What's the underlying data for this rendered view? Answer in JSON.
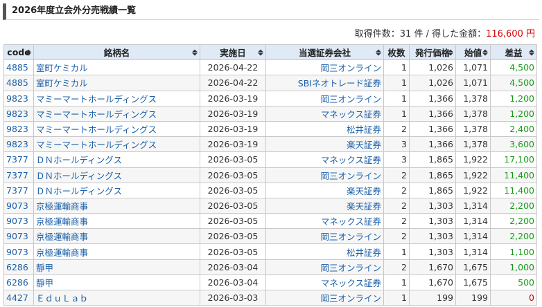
{
  "page_title": "2026年度立会外分売戦績一覧",
  "summary": {
    "prefix": "取得件数：31 件 / 得した金額：",
    "amount": "116,600 円",
    "accent_color": "#d50000"
  },
  "table": {
    "headers": [
      "code",
      "銘柄名",
      "実施日",
      "当選証券会社",
      "枚数",
      "発行価格",
      "始値",
      "差益"
    ],
    "rows": [
      {
        "code": "4885",
        "name": "室町ケミカル",
        "date": "2026-04-22",
        "broker": "岡三オンライン",
        "qty": "1",
        "price": "1,026",
        "open": "1,071",
        "profit": "4,500"
      },
      {
        "code": "4885",
        "name": "室町ケミカル",
        "date": "2026-04-22",
        "broker": "SBIネオトレード証券",
        "qty": "1",
        "price": "1,026",
        "open": "1,071",
        "profit": "4,500"
      },
      {
        "code": "9823",
        "name": "マミーマートホールディングス",
        "date": "2026-03-19",
        "broker": "岡三オンライン",
        "qty": "1",
        "price": "1,366",
        "open": "1,378",
        "profit": "1,200"
      },
      {
        "code": "9823",
        "name": "マミーマートホールディングス",
        "date": "2026-03-19",
        "broker": "マネックス証券",
        "qty": "1",
        "price": "1,366",
        "open": "1,378",
        "profit": "1,200"
      },
      {
        "code": "9823",
        "name": "マミーマートホールディングス",
        "date": "2026-03-19",
        "broker": "松井証券",
        "qty": "2",
        "price": "1,366",
        "open": "1,378",
        "profit": "2,400"
      },
      {
        "code": "9823",
        "name": "マミーマートホールディングス",
        "date": "2026-03-19",
        "broker": "楽天証券",
        "qty": "3",
        "price": "1,366",
        "open": "1,378",
        "profit": "3,600"
      },
      {
        "code": "7377",
        "name": "ＤＮホールディングス",
        "date": "2026-03-05",
        "broker": "マネックス証券",
        "qty": "3",
        "price": "1,865",
        "open": "1,922",
        "profit": "17,100"
      },
      {
        "code": "7377",
        "name": "ＤＮホールディングス",
        "date": "2026-03-05",
        "broker": "岡三オンライン",
        "qty": "2",
        "price": "1,865",
        "open": "1,922",
        "profit": "11,400"
      },
      {
        "code": "7377",
        "name": "ＤＮホールディングス",
        "date": "2026-03-05",
        "broker": "楽天証券",
        "qty": "2",
        "price": "1,865",
        "open": "1,922",
        "profit": "11,400"
      },
      {
        "code": "9073",
        "name": "京極運輸商事",
        "date": "2026-03-05",
        "broker": "楽天証券",
        "qty": "2",
        "price": "1,303",
        "open": "1,314",
        "profit": "2,200"
      },
      {
        "code": "9073",
        "name": "京極運輸商事",
        "date": "2026-03-05",
        "broker": "マネックス証券",
        "qty": "2",
        "price": "1,303",
        "open": "1,314",
        "profit": "2,200"
      },
      {
        "code": "9073",
        "name": "京極運輸商事",
        "date": "2026-03-05",
        "broker": "岡三オンライン",
        "qty": "2",
        "price": "1,303",
        "open": "1,314",
        "profit": "2,200"
      },
      {
        "code": "9073",
        "name": "京極運輸商事",
        "date": "2026-03-05",
        "broker": "松井証券",
        "qty": "1",
        "price": "1,303",
        "open": "1,314",
        "profit": "1,100"
      },
      {
        "code": "6286",
        "name": "靜甲",
        "date": "2026-03-04",
        "broker": "岡三オンライン",
        "qty": "2",
        "price": "1,670",
        "open": "1,675",
        "profit": "1,000"
      },
      {
        "code": "6286",
        "name": "靜甲",
        "date": "2026-03-04",
        "broker": "マネックス証券",
        "qty": "1",
        "price": "1,670",
        "open": "1,675",
        "profit": "500"
      },
      {
        "code": "4427",
        "name": "ＥｄｕＬａｂ",
        "date": "2026-03-03",
        "broker": "岡三オンライン",
        "qty": "1",
        "price": "199",
        "open": "199",
        "profit": "0"
      }
    ]
  }
}
